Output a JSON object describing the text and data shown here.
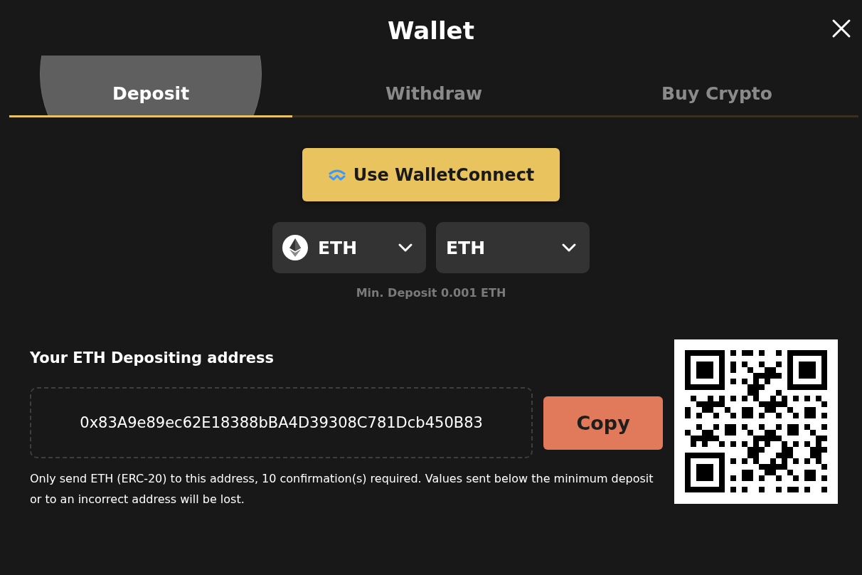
{
  "window": {
    "title": "Wallet"
  },
  "tabs": [
    {
      "label": "Deposit",
      "selected": true
    },
    {
      "label": "Withdraw",
      "selected": false
    },
    {
      "label": "Buy Crypto",
      "selected": false
    }
  ],
  "connect_button": {
    "label": "Use WalletConnect"
  },
  "selectors": [
    {
      "kind": "coin",
      "label": "ETH"
    },
    {
      "kind": "network",
      "label": "ETH"
    }
  ],
  "min_deposit": "Min. Deposit 0.001 ETH",
  "address": {
    "label": "Your ETH Depositing address",
    "value": "0x83A9e89ec62E18388bBA4D39308C781Dcb450B83",
    "copy_button": "Copy",
    "note": "Only send ETH (ERC-20) to this address, 10 confirmation(s) required. Values sent below the minimum deposit or to an incorrect address will be lost."
  }
}
